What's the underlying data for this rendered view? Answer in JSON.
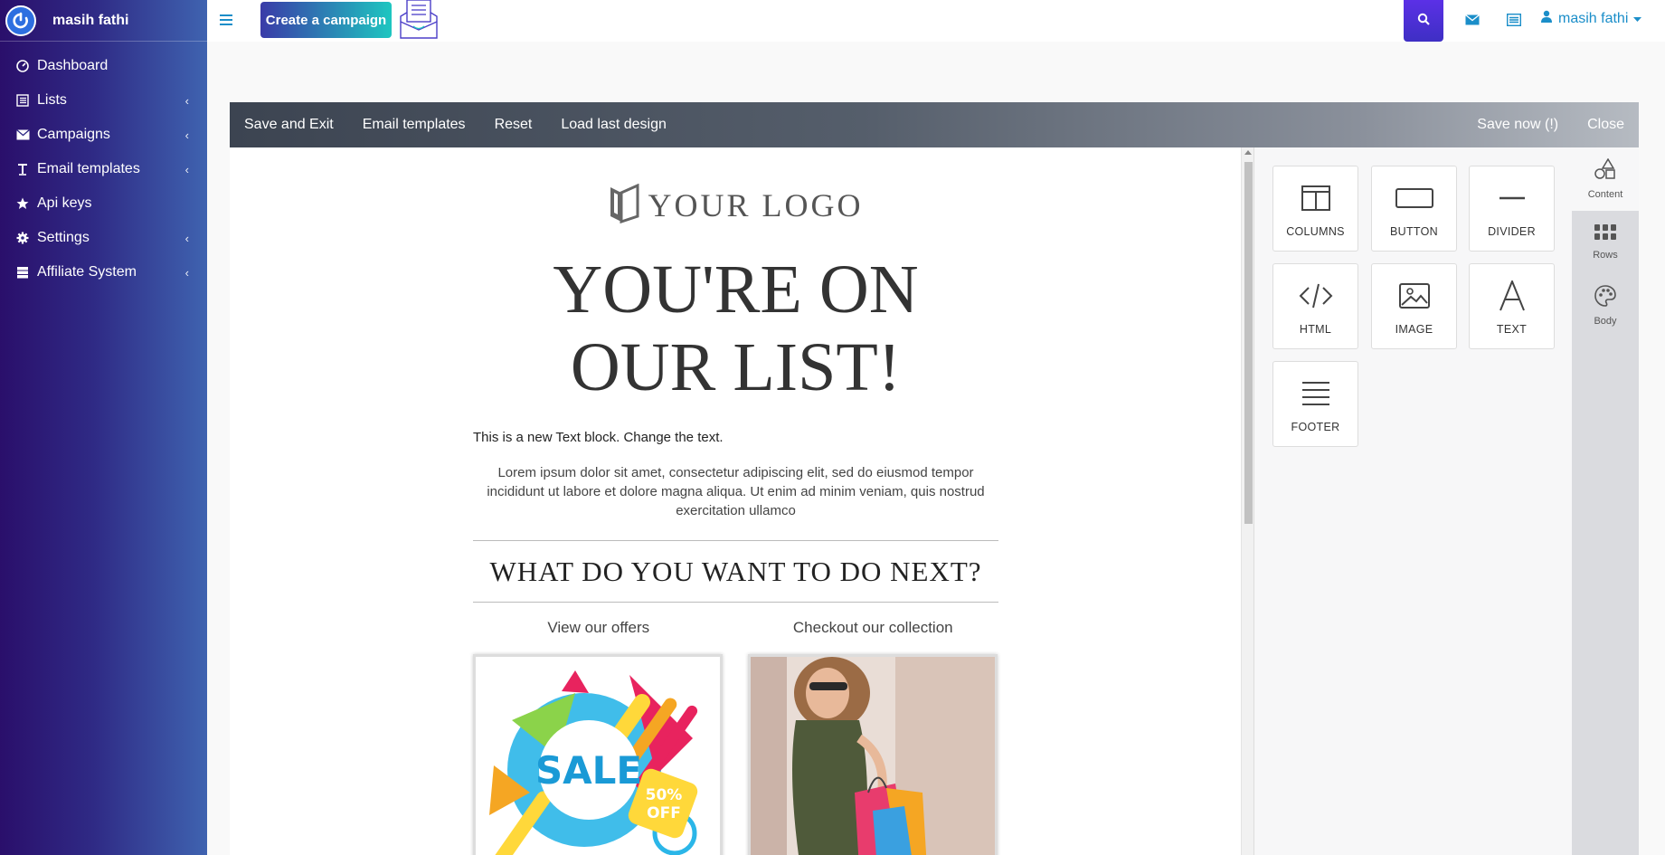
{
  "sidebar": {
    "brand_name": "masih fathi",
    "items": [
      {
        "label": "Dashboard",
        "icon": "dashboard-icon",
        "chevron": false
      },
      {
        "label": "Lists",
        "icon": "list-icon",
        "chevron": true
      },
      {
        "label": "Campaigns",
        "icon": "envelope-icon",
        "chevron": true
      },
      {
        "label": "Email templates",
        "icon": "text-icon",
        "chevron": true
      },
      {
        "label": "Api keys",
        "icon": "star-icon",
        "chevron": false
      },
      {
        "label": "Settings",
        "icon": "gear-icon",
        "chevron": true
      },
      {
        "label": "Affiliate System",
        "icon": "server-icon",
        "chevron": true
      }
    ]
  },
  "topbar": {
    "create_label": "Create a campaign",
    "user_name": "masih fathi"
  },
  "editor": {
    "toolbar": {
      "save_exit": "Save and Exit",
      "email_templates": "Email templates",
      "reset": "Reset",
      "load_last": "Load last design",
      "save_now": "Save now (!)",
      "close": "Close"
    },
    "email": {
      "logo_text": "YOUR LOGO",
      "hero_line1": "YOU'RE ON",
      "hero_line2": "OUR LIST!",
      "text_block": "This is a new Text block. Change the text.",
      "lorem": "Lorem ipsum dolor sit amet, consectetur adipiscing elit, sed do eiusmod tempor incididunt ut labore et dolore magna aliqua. Ut enim ad minim veniam, quis nostrud exercitation ullamco",
      "next_title": "WHAT DO YOU WANT TO DO NEXT?",
      "col1_label": "View our offers",
      "col2_label": "Checkout our collection",
      "sale_text": "SALE",
      "sale_badge_1": "50%",
      "sale_badge_2": "OFF"
    },
    "content_tiles": {
      "columns": "COLUMNS",
      "button": "BUTTON",
      "divider": "DIVIDER",
      "html": "HTML",
      "image": "IMAGE",
      "text": "TEXT",
      "footer": "FOOTER"
    },
    "tabs": {
      "content": "Content",
      "rows": "Rows",
      "body": "Body"
    }
  },
  "colors": {
    "accent": "#1b8ec9",
    "sidebar_start": "#2a0f6b",
    "sidebar_end": "#3f63b0"
  }
}
